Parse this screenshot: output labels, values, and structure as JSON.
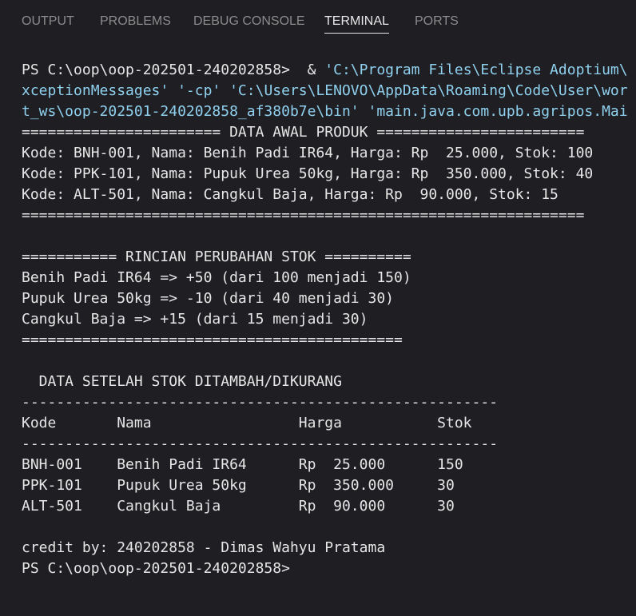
{
  "panel": {
    "tabs": [
      {
        "label": "OUTPUT",
        "active": false
      },
      {
        "label": "PROBLEMS",
        "active": false
      },
      {
        "label": "DEBUG CONSOLE",
        "active": false
      },
      {
        "label": "TERMINAL",
        "active": true
      },
      {
        "label": "PORTS",
        "active": false
      }
    ]
  },
  "terminal": {
    "command": {
      "prompt": "PS C:\\oop\\oop-202501-240202858> ",
      "operator": " & ",
      "path1": "'C:\\Program Files\\Eclipse Adoptium\\",
      "line2_str1": "xceptionMessages'",
      "line2_cp": " '-cp' ",
      "line2_str2": "'C:\\Users\\LENOVO\\AppData\\Roaming\\Code\\User\\wor",
      "line3": "t_ws\\oop-202501-240202858_af380b7e\\bin' 'main.java.com.upb.agripos.Mai"
    },
    "lines": [
      "======================= DATA AWAL PRODUK ========================",
      "Kode: BNH-001, Nama: Benih Padi IR64, Harga: Rp  25.000, Stok: 100",
      "Kode: PPK-101, Nama: Pupuk Urea 50kg, Harga: Rp  350.000, Stok: 40",
      "Kode: ALT-501, Nama: Cangkul Baja, Harga: Rp  90.000, Stok: 15",
      "=================================================================",
      "",
      "=========== RINCIAN PERUBAHAN STOK ==========",
      "Benih Padi IR64 => +50 (dari 100 menjadi 150)",
      "Pupuk Urea 50kg => -10 (dari 40 menjadi 30)",
      "Cangkul Baja => +15 (dari 15 menjadi 30)",
      "============================================",
      "",
      "  DATA SETELAH STOK DITAMBAH/DIKURANG",
      "-------------------------------------------------------",
      "Kode       Nama                 Harga           Stok",
      "-------------------------------------------------------",
      "BNH-001    Benih Padi IR64      Rp  25.000      150",
      "PPK-101    Pupuk Urea 50kg      Rp  350.000     30",
      "ALT-501    Cangkul Baja         Rp  90.000      30",
      "",
      "credit by: 240202858 - Dimas Wahyu Pratama",
      "PS C:\\oop\\oop-202501-240202858>"
    ]
  },
  "colors": {
    "background": "#1f1f23",
    "text": "#e6e6e6",
    "string": "#8fd0ee",
    "tab_inactive": "#8b8b8b",
    "tab_active": "#e7e7e7"
  }
}
